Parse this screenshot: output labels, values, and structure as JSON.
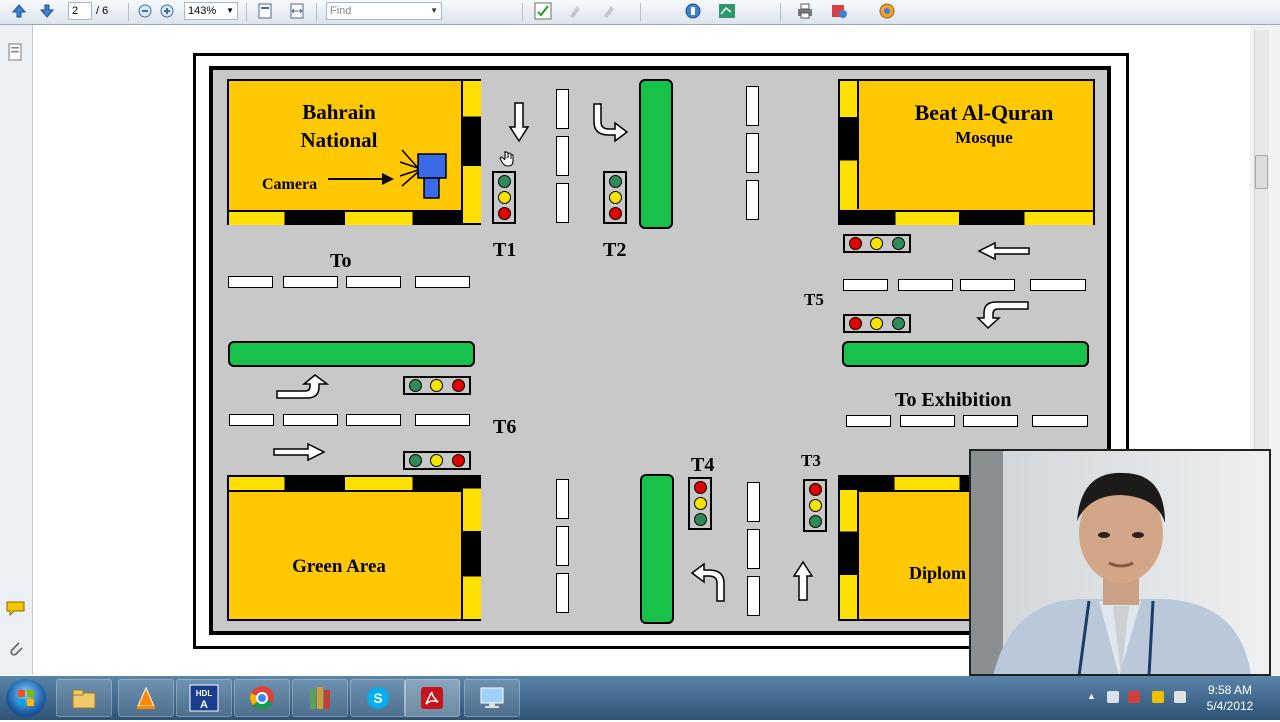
{
  "toolbar": {
    "page_current": "2",
    "page_total": "/ 6",
    "zoom": "143%",
    "find_placeholder": "Find",
    "icons": [
      "prev-page-icon",
      "next-page-icon",
      "zoom-out-icon",
      "zoom-in-icon",
      "fit-page-icon",
      "fit-width-icon",
      "spellcheck-icon",
      "highlight-icon",
      "stamp-icon",
      "attach-icon",
      "sign-icon",
      "collaborate-icon",
      "print-icon",
      "export-icon",
      "share-icon"
    ]
  },
  "map": {
    "buildings": {
      "top_left_line1": "Bahrain",
      "top_left_line2": "National",
      "camera_label": "Camera",
      "top_right_line1": "Beat Al-Quran",
      "top_right_line2": "Mosque",
      "bottom_left": "Green Area",
      "bottom_right": "Diplom"
    },
    "signals": {
      "t1": "T1",
      "t2": "T2",
      "t3": "T3",
      "t4": "T4",
      "t5": "T5",
      "t6": "T6"
    },
    "directions": {
      "to_west": "To",
      "to_exhibition": "To Exhibition"
    },
    "colors": {
      "building": "#ffc800",
      "median": "#18c24a",
      "red": "#e00000",
      "yellow": "#f5e400",
      "green": "#2e8b57"
    }
  },
  "taskbar": {
    "time": "9:58 AM",
    "date": "5/4/2012",
    "apps": [
      "explorer-icon",
      "vlc-icon",
      "hdl-icon",
      "chrome-icon",
      "books-icon",
      "skype-icon",
      "acrobat-icon",
      "remote-desktop-icon"
    ]
  }
}
